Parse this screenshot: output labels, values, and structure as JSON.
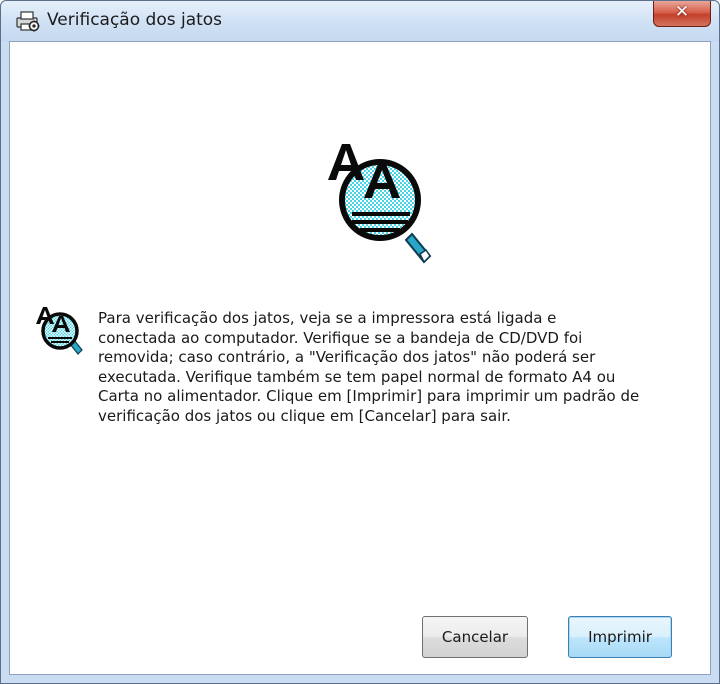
{
  "window": {
    "title": "Verificação dos jatos",
    "close_glyph": "✕"
  },
  "icons": {
    "title_icon": "printer-gear-icon",
    "main_icon": "nozzle-check-magnifier-icon",
    "message_icon": "nozzle-check-magnifier-icon"
  },
  "message": {
    "lines": [
      "Para verificação dos jatos, veja se a impressora está ligada e",
      "conectada ao computador. Verifique se a bandeja de CD/DVD foi",
      "removida; caso contrário, a \"Verificação dos jatos\" não poderá ser",
      "executada. Verifique também se tem papel normal de formato A4 ou",
      "Carta no alimentador. Clique em [Imprimir] para imprimir um padrão de",
      "verificação dos jatos ou clique em [Cancelar] para sair."
    ]
  },
  "buttons": {
    "cancel": "Cancelar",
    "print": "Imprimir"
  },
  "colors": {
    "magnifier_fill": "#40d0e0",
    "close_button": "#c94a35",
    "default_button_border": "#3c7fb1"
  }
}
